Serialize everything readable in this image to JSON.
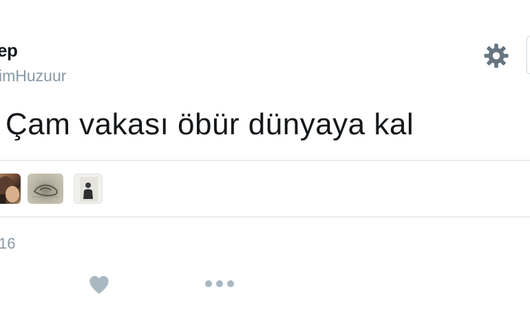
{
  "tweet": {
    "display_name": "ep",
    "handle": "imHuzuur",
    "text": "Çam vakası öbür dünyaya kal",
    "timestamp": "16"
  },
  "icons": {
    "settings": "gear-icon",
    "like": "heart-icon",
    "more": "more-dots-icon"
  },
  "colors": {
    "text": "#14171a",
    "secondary": "#8899a6",
    "icon": "#66757f",
    "action_icon": "#aab8c2",
    "divider": "#e6ecf0"
  }
}
